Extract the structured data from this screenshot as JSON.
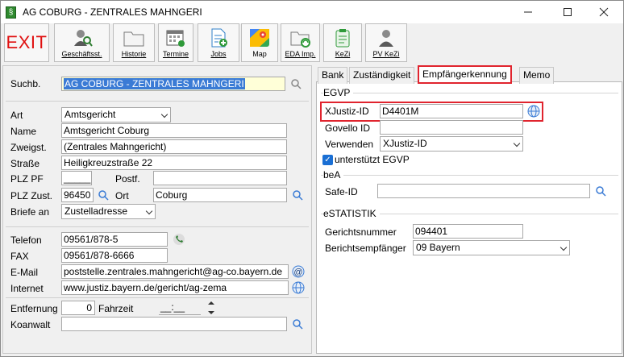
{
  "window": {
    "title": "AG COBURG - ZENTRALES MAHNGERI",
    "app_icon": "§"
  },
  "toolbar": {
    "exit_label": "EXIT",
    "buttons": [
      {
        "label": "Geschäftsst.",
        "icon": "person-search-icon"
      },
      {
        "label": "Historie",
        "icon": "folder-icon"
      },
      {
        "label": "Termine",
        "icon": "calendar-icon"
      },
      {
        "label": "Jobs",
        "icon": "document-add-icon"
      },
      {
        "label": "Map",
        "icon": "google-maps-icon"
      },
      {
        "label": "EDA Imp.",
        "icon": "folder-sync-icon"
      },
      {
        "label": "KeZi",
        "icon": "clipboard-icon"
      },
      {
        "label": "PV KeZi",
        "icon": "person-clipboard-icon"
      }
    ]
  },
  "left": {
    "suchb_label": "Suchb.",
    "suchb_value": "AG COBURG - ZENTRALES MAHNGERI",
    "art_label": "Art",
    "art_value": "Amtsgericht",
    "name_label": "Name",
    "name_value": "Amtsgericht Coburg",
    "zweigst_label": "Zweigst.",
    "zweigst_value": "(Zentrales Mahngericht)",
    "strasse_label": "Straße",
    "strasse_value": "Heiligkreuzstraße 22",
    "plzpf_label": "PLZ PF",
    "plzpf_value": "_____",
    "postf_label": "Postf.",
    "postf_value": "",
    "plzzust_label": "PLZ Zust.",
    "plzzust_value": "96450",
    "ort_label": "Ort",
    "ort_value": "Coburg",
    "briefe_label": "Briefe an",
    "briefe_value": "Zustelladresse",
    "telefon_label": "Telefon",
    "telefon_value": "09561/878-5",
    "fax_label": "FAX",
    "fax_value": "09561/878-6666",
    "email_label": "E-Mail",
    "email_value": "poststelle.zentrales.mahngericht@ag-co.bayern.de",
    "internet_label": "Internet",
    "internet_value": "www.justiz.bayern.de/gericht/ag-zema",
    "entfernung_label": "Entfernung",
    "entfernung_value": "0",
    "fahrzeit_label": "Fahrzeit",
    "fahrzeit_value": "__:__",
    "koanwalt_label": "Koanwalt",
    "koanwalt_value": ""
  },
  "tabs": [
    {
      "label": "Bank",
      "active": false
    },
    {
      "label": "Zuständigkeit",
      "active": false
    },
    {
      "label": "Empfängerkennung",
      "active": true
    },
    {
      "label": "Memo",
      "active": false
    }
  ],
  "egvp": {
    "group_title": "EGVP",
    "xjustiz_label": "XJustiz-ID",
    "xjustiz_value": "D4401M",
    "govello_label": "Govello ID",
    "govello_value": "",
    "verwenden_label": "Verwenden",
    "verwenden_value": "XJustiz-ID",
    "checkbox_label": "unterstützt EGVP",
    "checkbox_checked": true
  },
  "bea": {
    "group_title": "beA",
    "safe_label": "Safe-ID",
    "safe_value": ""
  },
  "estatistik": {
    "group_title": "eSTATISTIK",
    "gerichtsnummer_label": "Gerichtsnummer",
    "gerichtsnummer_value": "094401",
    "berichtsempfaenger_label": "Berichtsempfänger",
    "berichtsempfaenger_value": "09 Bayern"
  },
  "colors": {
    "accent_red": "#e0242e",
    "exit_red": "#e01010",
    "checkbox_blue": "#1a6fd4",
    "highlight_yellow": "#ffffd8"
  }
}
